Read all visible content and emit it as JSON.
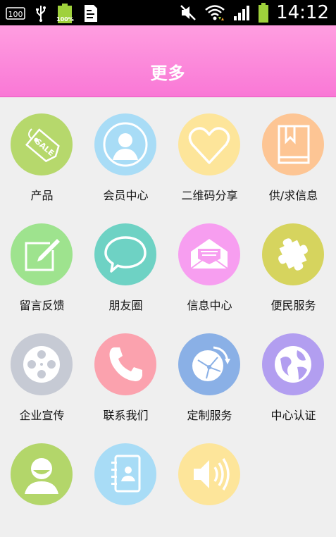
{
  "status_bar": {
    "time": "14:12",
    "battery_percent": "100%",
    "notif_count": "100"
  },
  "header": {
    "title": "更多"
  },
  "tiles": [
    {
      "label": "产品",
      "icon": "sale-tag-icon",
      "color": "#b6d86c"
    },
    {
      "label": "会员中心",
      "icon": "member-avatar-icon",
      "color": "#a8dcf6"
    },
    {
      "label": "二维码分享",
      "icon": "heart-icon",
      "color": "#fde59a"
    },
    {
      "label": "供/求信息",
      "icon": "book-icon",
      "color": "#fdc594"
    },
    {
      "label": "留言反馈",
      "icon": "edit-icon",
      "color": "#9ee38e"
    },
    {
      "label": "朋友圈",
      "icon": "chat-bubble-icon",
      "color": "#6ed2c4"
    },
    {
      "label": "信息中心",
      "icon": "envelope-icon",
      "color": "#f79ef0"
    },
    {
      "label": "便民服务",
      "icon": "puzzle-icon",
      "color": "#d6d45e"
    },
    {
      "label": "企业宣传",
      "icon": "film-reel-icon",
      "color": "#c6cad4"
    },
    {
      "label": "联系我们",
      "icon": "phone-icon",
      "color": "#fba2ae"
    },
    {
      "label": "定制服务",
      "icon": "network-globe-icon",
      "color": "#8ab0e6"
    },
    {
      "label": "中心认证",
      "icon": "globe-icon",
      "color": "#b29ef0"
    },
    {
      "label": "",
      "icon": "user-icon",
      "color": "#b3d66a"
    },
    {
      "label": "",
      "icon": "contacts-icon",
      "color": "#a8dcf6"
    },
    {
      "label": "",
      "icon": "speaker-icon",
      "color": "#fde59a"
    }
  ]
}
